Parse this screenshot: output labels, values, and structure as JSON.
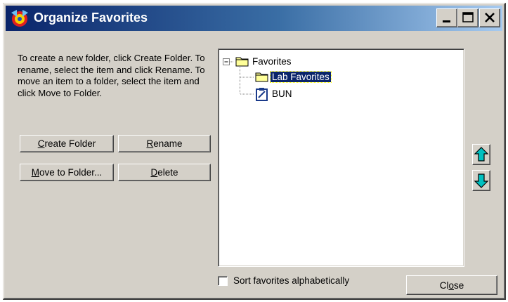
{
  "window": {
    "title": "Organize Favorites",
    "minimize_label": "_",
    "maximize_label": "□",
    "close_label": "×"
  },
  "instructions": "To create a new folder, click Create Folder.  To rename, select the item and click Rename.  To move an item to a folder, select the item and click Move to Folder.",
  "buttons": {
    "create_folder": {
      "underline": "C",
      "rest": "reate Folder"
    },
    "rename": {
      "underline": "R",
      "rest": "ename"
    },
    "move_to_folder": {
      "underline": "M",
      "rest": "ove to Folder..."
    },
    "delete": {
      "underline": "D",
      "rest": "elete"
    },
    "close": {
      "before": "Cl",
      "underline": "o",
      "after": "se"
    }
  },
  "tree": {
    "root": {
      "label": "Favorites",
      "icon": "folder-icon",
      "expanded": true
    },
    "children": [
      {
        "label": "Lab Favorites",
        "icon": "folder-icon",
        "selected": true
      },
      {
        "label": "BUN",
        "icon": "clipboard-icon",
        "selected": false
      }
    ]
  },
  "sort_alphabetically": {
    "label": "Sort favorites alphabetically",
    "checked": false
  },
  "colors": {
    "titlebar_start": "#0a246a",
    "titlebar_end": "#a6caf0",
    "face": "#d4d0c8",
    "selection": "#0a246a",
    "arrow": "#00c0c0",
    "folder": "#ffff99"
  }
}
